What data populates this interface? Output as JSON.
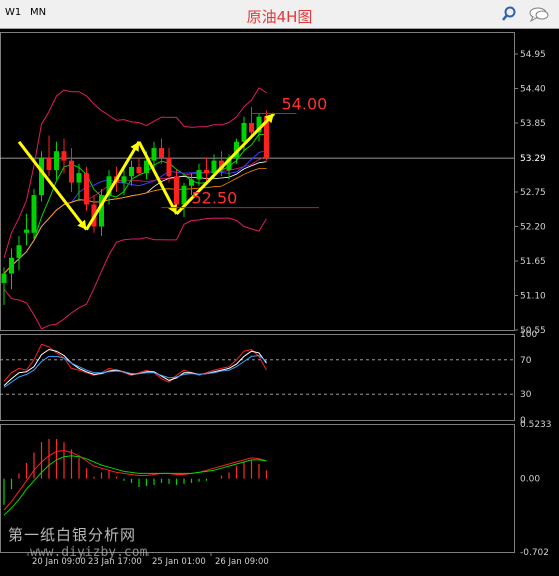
{
  "toolbar": {
    "timeframes": [
      "W1",
      "MN"
    ],
    "icons": [
      "search-icon",
      "chat-icon"
    ]
  },
  "title": "原油4H图",
  "watermark": {
    "text": "第一纸白银分析网",
    "url": "www.diyizby.com"
  },
  "colors": {
    "background": "#000000",
    "panel_border": "#7f7f7f",
    "axis_text": "#d0d0d0",
    "bull_candle": "#00d200",
    "bear_candle": "#ff2020",
    "bollinger": "#e01a6a",
    "ma_fast": "#00d800",
    "ma_mid": "#3a3aff",
    "ma_slow": "#ffffff",
    "ma_long": "#ff8c00",
    "annotation_arrows": "#ffff00",
    "level_text": "#ff3030",
    "level_line": "#c02020",
    "current_price_line": "#c8c8c8",
    "macd_hist_pos": "#ff2a2a",
    "macd_hist_neg": "#00d800"
  },
  "chart_data": [
    {
      "type": "candlestick",
      "title": "原油4H图",
      "ylim": [
        50.55,
        55.3
      ],
      "y_ticks": [
        "54.95",
        "54.40",
        "53.85",
        "53.29",
        "52.75",
        "52.20",
        "51.65",
        "51.10",
        "50.55"
      ],
      "current_price": "53.29",
      "x_ticks": [
        "20 Jan 09:00",
        "23 Jan 17:00",
        "25 Jan 01:00",
        "26 Jan 09:00"
      ],
      "candles": [
        {
          "o": 51.3,
          "h": 51.55,
          "l": 50.95,
          "c": 51.45
        },
        {
          "o": 51.45,
          "h": 51.85,
          "l": 51.2,
          "c": 51.7
        },
        {
          "o": 51.7,
          "h": 52.05,
          "l": 51.5,
          "c": 51.9
        },
        {
          "o": 52.1,
          "h": 52.4,
          "l": 51.9,
          "c": 52.15
        },
        {
          "o": 52.1,
          "h": 52.8,
          "l": 52.0,
          "c": 52.7
        },
        {
          "o": 52.7,
          "h": 53.4,
          "l": 52.6,
          "c": 53.3
        },
        {
          "o": 53.3,
          "h": 53.65,
          "l": 53.0,
          "c": 53.1
        },
        {
          "o": 53.1,
          "h": 53.55,
          "l": 52.95,
          "c": 53.4
        },
        {
          "o": 53.4,
          "h": 53.6,
          "l": 53.05,
          "c": 53.25
        },
        {
          "o": 53.25,
          "h": 53.45,
          "l": 52.75,
          "c": 52.9
        },
        {
          "o": 52.9,
          "h": 53.2,
          "l": 52.6,
          "c": 53.05
        },
        {
          "o": 53.05,
          "h": 53.15,
          "l": 52.45,
          "c": 52.55
        },
        {
          "o": 52.55,
          "h": 52.7,
          "l": 52.1,
          "c": 52.2
        },
        {
          "o": 52.2,
          "h": 52.8,
          "l": 52.05,
          "c": 52.7
        },
        {
          "o": 52.7,
          "h": 53.1,
          "l": 52.55,
          "c": 53.0
        },
        {
          "o": 53.0,
          "h": 53.15,
          "l": 52.75,
          "c": 52.9
        },
        {
          "o": 52.9,
          "h": 53.1,
          "l": 52.7,
          "c": 53.0
        },
        {
          "o": 53.0,
          "h": 53.25,
          "l": 52.85,
          "c": 53.15
        },
        {
          "o": 53.15,
          "h": 53.3,
          "l": 53.0,
          "c": 53.05
        },
        {
          "o": 53.05,
          "h": 53.4,
          "l": 52.95,
          "c": 53.25
        },
        {
          "o": 53.25,
          "h": 53.55,
          "l": 53.1,
          "c": 53.45
        },
        {
          "o": 53.45,
          "h": 53.6,
          "l": 53.2,
          "c": 53.3
        },
        {
          "o": 53.3,
          "h": 53.45,
          "l": 52.9,
          "c": 53.0
        },
        {
          "o": 53.0,
          "h": 53.1,
          "l": 52.5,
          "c": 52.55
        },
        {
          "o": 52.55,
          "h": 52.9,
          "l": 52.35,
          "c": 52.85
        },
        {
          "o": 52.85,
          "h": 53.05,
          "l": 52.7,
          "c": 52.95
        },
        {
          "o": 52.95,
          "h": 53.2,
          "l": 52.85,
          "c": 53.1
        },
        {
          "o": 53.1,
          "h": 53.3,
          "l": 52.9,
          "c": 53.05
        },
        {
          "o": 53.05,
          "h": 53.35,
          "l": 52.95,
          "c": 53.25
        },
        {
          "o": 53.25,
          "h": 53.4,
          "l": 53.0,
          "c": 53.1
        },
        {
          "o": 53.1,
          "h": 53.35,
          "l": 52.95,
          "c": 53.3
        },
        {
          "o": 53.3,
          "h": 53.6,
          "l": 53.2,
          "c": 53.55
        },
        {
          "o": 53.55,
          "h": 53.95,
          "l": 53.4,
          "c": 53.85
        },
        {
          "o": 53.85,
          "h": 54.1,
          "l": 53.6,
          "c": 53.7
        },
        {
          "o": 53.7,
          "h": 54.0,
          "l": 53.55,
          "c": 53.95
        },
        {
          "o": 53.95,
          "h": 54.05,
          "l": 53.25,
          "c": 53.29
        }
      ],
      "annotations": {
        "levels": [
          {
            "label": "54.00",
            "value": 54.0,
            "from_index": 33,
            "to_index": 39
          },
          {
            "label": "52.50",
            "value": 52.5,
            "from_index": 21,
            "to_index": 42
          }
        ],
        "zigzag": [
          {
            "i": 2,
            "price": 53.55
          },
          {
            "i": 11,
            "price": 52.15
          },
          {
            "i": 18,
            "price": 53.55
          },
          {
            "i": 23,
            "price": 52.4
          },
          {
            "i": 36,
            "price": 54.0
          }
        ]
      }
    },
    {
      "type": "line",
      "name": "stochastic",
      "ylim": [
        0,
        100
      ],
      "y_ticks": [
        "100",
        "70",
        "30",
        "0"
      ],
      "reference_levels": [
        70,
        30
      ],
      "series": [
        {
          "values": [
            45,
            55,
            60,
            58,
            70,
            88,
            85,
            78,
            72,
            60,
            58,
            55,
            52,
            55,
            60,
            58,
            55,
            52,
            55,
            58,
            55,
            48,
            44,
            52,
            58,
            55,
            52,
            55,
            58,
            60,
            62,
            70,
            80,
            82,
            74,
            58
          ]
        },
        {
          "values": [
            40,
            48,
            55,
            56,
            62,
            76,
            82,
            80,
            75,
            66,
            60,
            56,
            53,
            54,
            57,
            58,
            56,
            53,
            54,
            56,
            56,
            51,
            46,
            49,
            55,
            55,
            53,
            54,
            56,
            58,
            60,
            65,
            74,
            80,
            78,
            66
          ]
        },
        {
          "values": [
            38,
            44,
            50,
            53,
            58,
            68,
            74,
            74,
            72,
            66,
            62,
            58,
            55,
            55,
            56,
            57,
            56,
            54,
            54,
            55,
            55,
            52,
            49,
            50,
            53,
            54,
            53,
            54,
            55,
            57,
            58,
            62,
            68,
            74,
            75,
            68
          ]
        }
      ]
    },
    {
      "type": "bar",
      "name": "macd",
      "ylim": [
        -0.702,
        0.5233
      ],
      "y_ticks": [
        "0.5233",
        "0.00",
        "-0.702"
      ],
      "series": [
        {
          "values": [
            -0.25,
            -0.1,
            0.05,
            0.15,
            0.25,
            0.35,
            0.38,
            0.38,
            0.35,
            0.28,
            0.2,
            0.1,
            0.02,
            0.06,
            0.08,
            0.02,
            -0.02,
            -0.04,
            -0.08,
            -0.07,
            -0.06,
            -0.04,
            -0.05,
            -0.06,
            -0.05,
            -0.04,
            -0.03,
            -0.02,
            0.0,
            0.03,
            0.06,
            0.12,
            0.16,
            0.18,
            0.14,
            0.08
          ]
        },
        {
          "values": [
            -0.3,
            -0.22,
            -0.12,
            -0.02,
            0.08,
            0.16,
            0.22,
            0.26,
            0.27,
            0.25,
            0.22,
            0.17,
            0.12,
            0.1,
            0.08,
            0.06,
            0.05,
            0.04,
            0.03,
            0.03,
            0.04,
            0.05,
            0.05,
            0.04,
            0.04,
            0.05,
            0.06,
            0.08,
            0.1,
            0.12,
            0.14,
            0.16,
            0.18,
            0.2,
            0.19,
            0.17
          ]
        },
        {
          "values": [
            -0.35,
            -0.28,
            -0.2,
            -0.1,
            -0.02,
            0.06,
            0.13,
            0.18,
            0.21,
            0.22,
            0.21,
            0.19,
            0.16,
            0.13,
            0.11,
            0.09,
            0.07,
            0.06,
            0.05,
            0.05,
            0.05,
            0.05,
            0.05,
            0.05,
            0.05,
            0.05,
            0.06,
            0.07,
            0.08,
            0.1,
            0.12,
            0.14,
            0.16,
            0.18,
            0.18,
            0.17
          ]
        }
      ]
    }
  ]
}
